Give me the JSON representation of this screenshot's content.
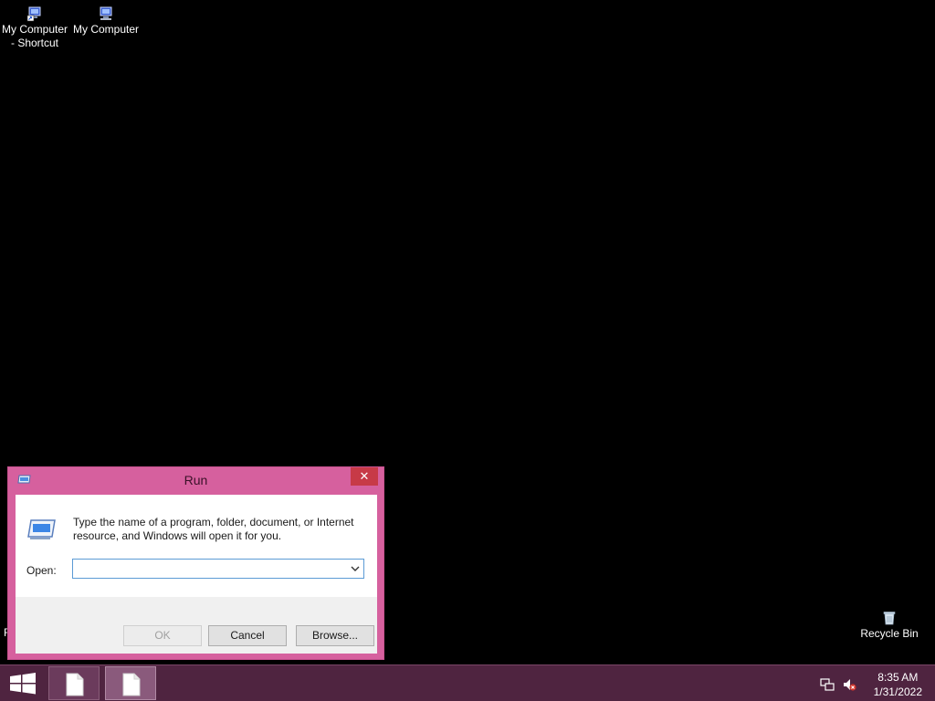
{
  "desktop": {
    "icons": [
      {
        "label_line1": "My Computer",
        "label_line2": "- Shortcut",
        "icon": "computer-shortcut-icon"
      },
      {
        "label_line1": "My Computer",
        "label_line2": "",
        "icon": "computer-icon"
      },
      {
        "label_line1": "Recycle Bin",
        "label_line2": "",
        "icon": "recycle-bin-icon"
      }
    ],
    "stray_text": "F"
  },
  "run_dialog": {
    "title": "Run",
    "close_label": "✕",
    "description": "Type the name of a program, folder, document, or Internet resource, and Windows will open it for you.",
    "open_label": "Open:",
    "open_value": "",
    "ok_label": "OK",
    "cancel_label": "Cancel",
    "browse_label": "Browse...",
    "colors": {
      "frame": "#d6609e",
      "close": "#c73a47",
      "focus_border": "#5b9bd5"
    }
  },
  "taskbar": {
    "time": "8:35 AM",
    "date": "1/31/2022",
    "buttons": [
      {
        "icon": "document-icon",
        "active": false
      },
      {
        "icon": "document-icon",
        "active": true
      }
    ],
    "tray": [
      "network-icon",
      "volume-muted-icon"
    ],
    "color": "#4f2440"
  }
}
